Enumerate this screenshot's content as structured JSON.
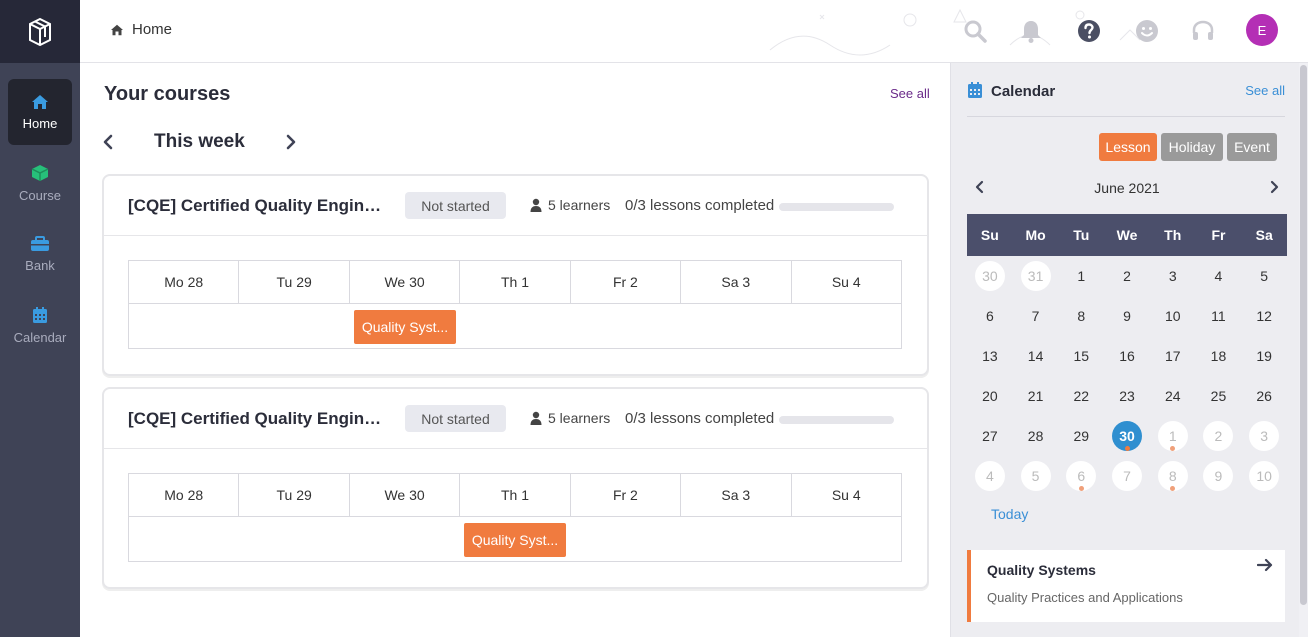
{
  "sidebar": {
    "items": [
      {
        "label": "Home",
        "icon": "home-icon",
        "active": true
      },
      {
        "label": "Course",
        "icon": "cube-icon",
        "active": false
      },
      {
        "label": "Bank",
        "icon": "toolbox-icon",
        "active": false
      },
      {
        "label": "Calendar",
        "icon": "calendar-icon",
        "active": false
      }
    ]
  },
  "header": {
    "breadcrumb": "Home",
    "avatar_initial": "E",
    "icons": [
      "search-icon",
      "bell-icon",
      "help-icon",
      "smiley-icon",
      "headset-icon"
    ]
  },
  "main": {
    "section_title": "Your courses",
    "see_all": "See all",
    "week_label": "This week",
    "courses": [
      {
        "title": "[CQE] Certified Quality Engine...",
        "status": "Not started",
        "learners": "5 learners",
        "lessons": "0/3 lessons completed",
        "progress": 0,
        "days": [
          "Mo 28",
          "Tu 29",
          "We 30",
          "Th 1",
          "Fr 2",
          "Sa 3",
          "Su 4"
        ],
        "lesson_chip": "Quality Syst...",
        "lesson_day": "We 30"
      },
      {
        "title": "[CQE] Certified Quality Engine...",
        "status": "Not started",
        "learners": "5 learners",
        "lessons": "0/3 lessons completed",
        "progress": 0,
        "days": [
          "Mo 28",
          "Tu 29",
          "We 30",
          "Th 1",
          "Fr 2",
          "Sa 3",
          "Su 4"
        ],
        "lesson_chip": "Quality Syst...",
        "lesson_day": "Th 1"
      }
    ]
  },
  "calendar": {
    "title": "Calendar",
    "see_all": "See all",
    "filters": [
      {
        "label": "Lesson",
        "color": "#f07b3f"
      },
      {
        "label": "Holiday",
        "color": "#9a9a9a"
      },
      {
        "label": "Event",
        "color": "#9a9a9a"
      }
    ],
    "month": "June 2021",
    "dow": [
      "Su",
      "Mo",
      "Tu",
      "We",
      "Th",
      "Fr",
      "Sa"
    ],
    "weeks": [
      [
        "30",
        "31",
        "1",
        "2",
        "3",
        "4",
        "5"
      ],
      [
        "6",
        "7",
        "8",
        "9",
        "10",
        "11",
        "12"
      ],
      [
        "13",
        "14",
        "15",
        "16",
        "17",
        "18",
        "19"
      ],
      [
        "20",
        "21",
        "22",
        "23",
        "24",
        "25",
        "26"
      ],
      [
        "27",
        "28",
        "29",
        "30",
        "1",
        "2",
        "3"
      ],
      [
        "4",
        "5",
        "6",
        "7",
        "8",
        "9",
        "10"
      ]
    ],
    "today_link": "Today",
    "upcoming": {
      "title": "Quality Systems",
      "subtitle": "Quality Practices and Applications"
    },
    "accent_color": "#2f8fd0"
  }
}
